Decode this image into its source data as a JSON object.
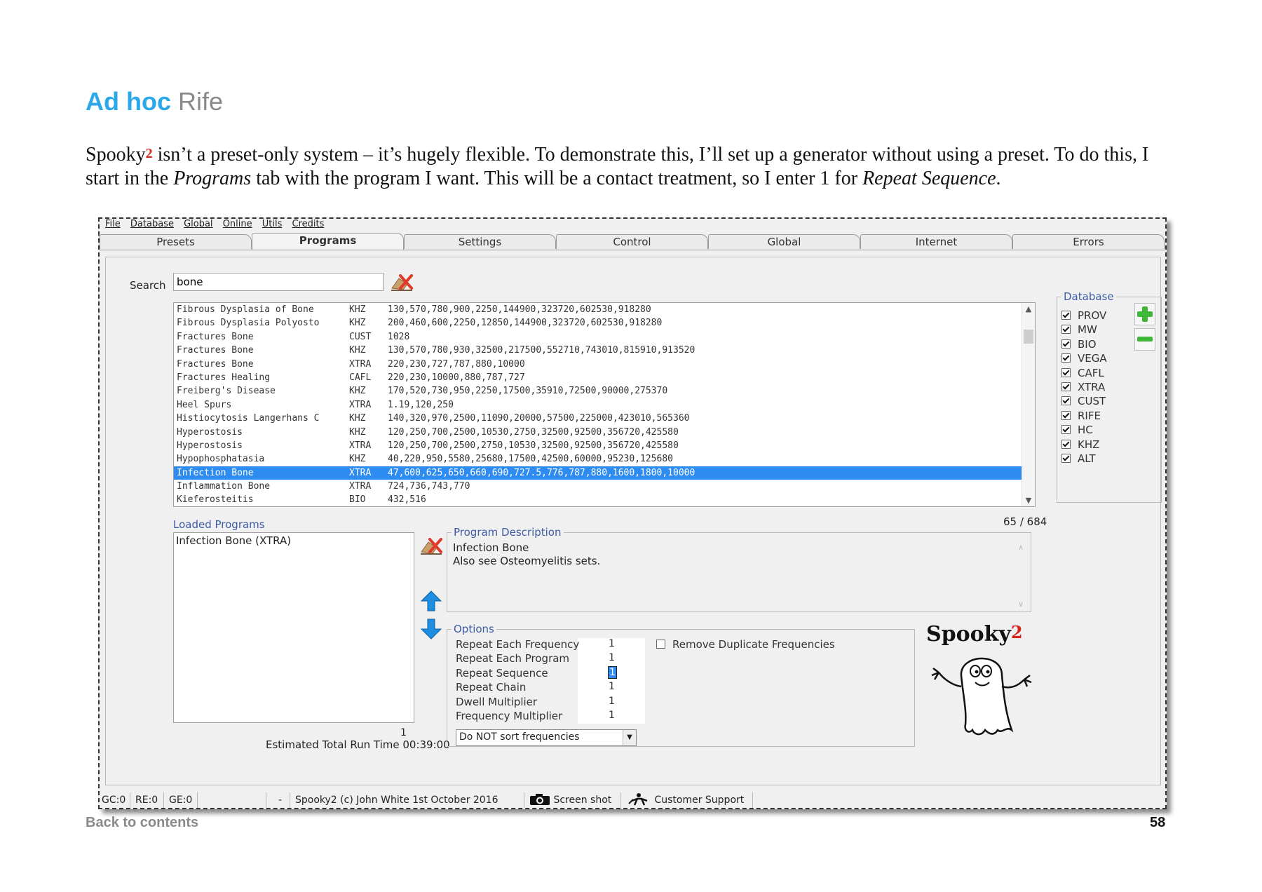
{
  "doc": {
    "title_accent": "Ad hoc",
    "title_rest": " Rife",
    "intro": {
      "p1": "Spooky",
      "p1_sup": "2",
      "p2": " isn’t a preset-only system – it’s hugely flexible. To demonstrate this, I’ll set up a generator without using a preset. To do this, I start in the ",
      "p3": "Programs",
      "p4": " tab with the program I want. This will be a contact treatment, so I enter 1 for ",
      "p5": "Repeat Sequence",
      "p6": "."
    },
    "back_link": "Back to contents",
    "page_number": "58"
  },
  "app": {
    "menu": [
      "File",
      "Database",
      "Global",
      "Online",
      "Utils",
      "Credits"
    ],
    "tabs": [
      "Presets",
      "Programs",
      "Settings",
      "Control",
      "Global",
      "Internet",
      "Errors"
    ],
    "active_tab": "Programs",
    "search": {
      "label": "Search",
      "value": "bone"
    },
    "programs": [
      {
        "name": "Fibrous Dysplasia of Bone",
        "db": "KHZ",
        "freqs": "130,570,780,900,2250,144900,323720,602530,918280"
      },
      {
        "name": "Fibrous Dysplasia Polyosto",
        "db": "KHZ",
        "freqs": "200,460,600,2250,12850,144900,323720,602530,918280"
      },
      {
        "name": "Fractures Bone",
        "db": "CUST",
        "freqs": "1028"
      },
      {
        "name": "Fractures Bone",
        "db": "KHZ",
        "freqs": "130,570,780,930,32500,217500,552710,743010,815910,913520"
      },
      {
        "name": "Fractures Bone",
        "db": "XTRA",
        "freqs": "220,230,727,787,880,10000"
      },
      {
        "name": "Fractures Healing",
        "db": "CAFL",
        "freqs": "220,230,10000,880,787,727"
      },
      {
        "name": "Freiberg's Disease",
        "db": "KHZ",
        "freqs": "170,520,730,950,2250,17500,35910,72500,90000,275370"
      },
      {
        "name": "Heel Spurs",
        "db": "XTRA",
        "freqs": "1.19,120,250"
      },
      {
        "name": "Histiocytosis Langerhans C",
        "db": "KHZ",
        "freqs": "140,320,970,2500,11090,20000,57500,225000,423010,565360"
      },
      {
        "name": "Hyperostosis",
        "db": "KHZ",
        "freqs": "120,250,700,2500,10530,2750,32500,92500,356720,425580"
      },
      {
        "name": "Hyperostosis",
        "db": "XTRA",
        "freqs": "120,250,700,2500,2750,10530,32500,92500,356720,425580"
      },
      {
        "name": "Hypophosphatasia",
        "db": "KHZ",
        "freqs": "40,220,950,5580,25680,17500,42500,60000,95230,125680"
      },
      {
        "name": "Infection Bone",
        "db": "XTRA",
        "freqs": "47,600,625,650,660,690,727.5,776,787,880,1600,1800,10000",
        "selected": true
      },
      {
        "name": "Inflammation Bone",
        "db": "XTRA",
        "freqs": "724,736,743,770"
      },
      {
        "name": "Kieferosteitis",
        "db": "BIO",
        "freqs": "432,516"
      }
    ],
    "result_count": "65 / 684",
    "database": {
      "title": "Database",
      "items": [
        {
          "label": "PROV",
          "checked": true
        },
        {
          "label": "MW",
          "checked": true
        },
        {
          "label": "BIO",
          "checked": true
        },
        {
          "label": "VEGA",
          "checked": true
        },
        {
          "label": "CAFL",
          "checked": true
        },
        {
          "label": "XTRA",
          "checked": true
        },
        {
          "label": "CUST",
          "checked": true
        },
        {
          "label": "RIFE",
          "checked": true
        },
        {
          "label": "HC",
          "checked": true
        },
        {
          "label": "KHZ",
          "checked": true
        },
        {
          "label": "ALT",
          "checked": true
        }
      ]
    },
    "loaded": {
      "label": "Loaded Programs",
      "items": [
        "Infection Bone (XTRA)"
      ],
      "count": "1",
      "runtime": "Estimated Total Run Time 00:39:00"
    },
    "description": {
      "title": "Program Description",
      "line1": "Infection Bone",
      "line2": "Also see Osteomyelitis sets."
    },
    "options": {
      "title": "Options",
      "rows": [
        {
          "label": "Repeat Each Frequency",
          "value": "1"
        },
        {
          "label": "Repeat Each Program",
          "value": "1"
        },
        {
          "label": "Repeat Sequence",
          "value": "1",
          "selected": true
        },
        {
          "label": "Repeat Chain",
          "value": "1"
        },
        {
          "label": "Dwell Multiplier",
          "value": "1"
        },
        {
          "label": "Frequency Multiplier",
          "value": "1"
        }
      ],
      "remove_duplicates": {
        "label": "Remove Duplicate Frequencies",
        "checked": false
      },
      "sort": "Do NOT sort frequencies"
    },
    "logo": {
      "text": "Spooky",
      "sup": "2"
    },
    "status": {
      "gc": "GC:0",
      "re": "RE:0",
      "ge": "GE:0",
      "dash": "-",
      "copyright": "Spooky2 (c) John White 1st October 2016",
      "screenshot": "Screen shot",
      "support": "Customer Support"
    },
    "colors": {
      "accent": "#2aa8e8",
      "selection": "#2e8cf0",
      "group_title": "#3d5aa6",
      "sup_red": "#d4281f"
    }
  }
}
